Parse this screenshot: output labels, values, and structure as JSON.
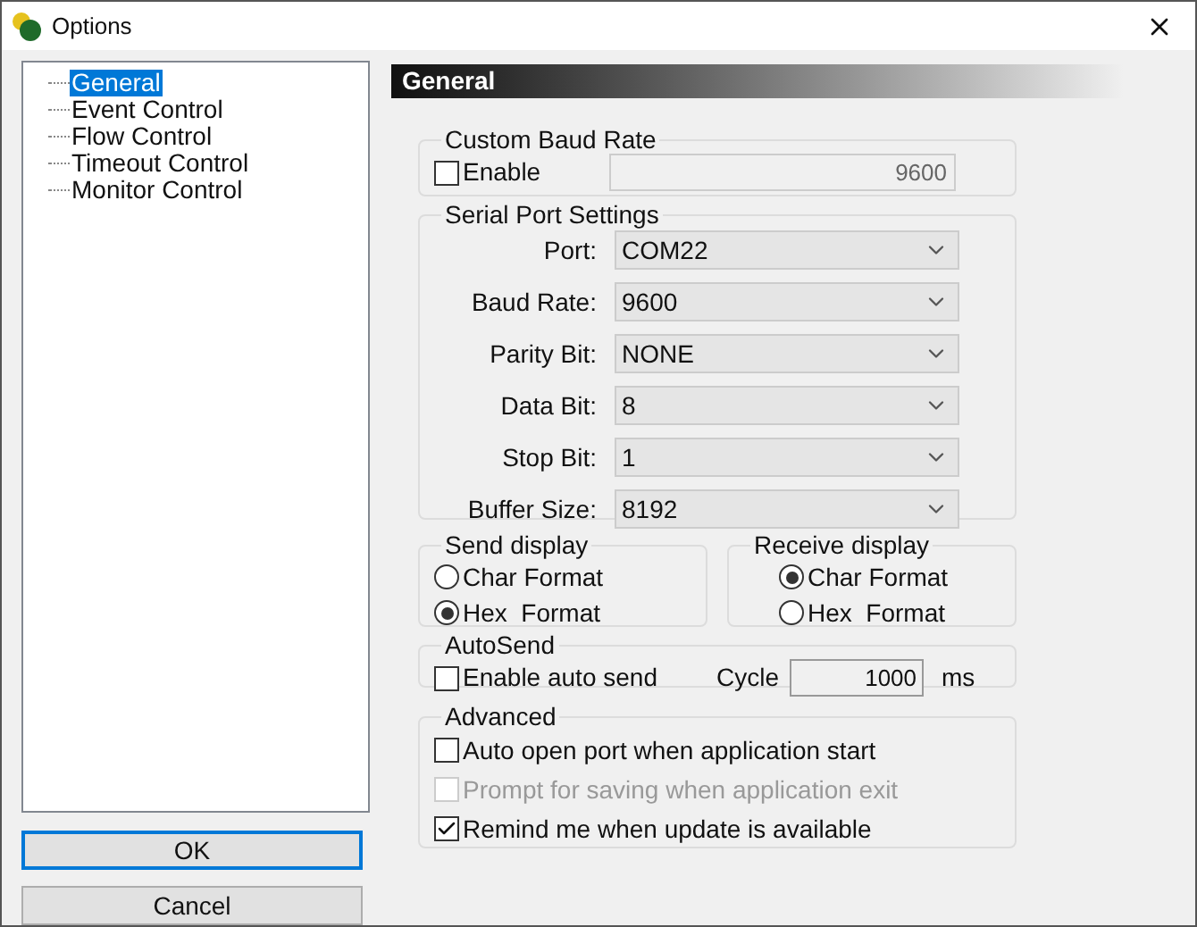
{
  "window": {
    "title": "Options"
  },
  "tree": {
    "items": [
      {
        "label": "General",
        "selected": true
      },
      {
        "label": "Event Control",
        "selected": false
      },
      {
        "label": "Flow Control",
        "selected": false
      },
      {
        "label": "Timeout Control",
        "selected": false
      },
      {
        "label": "Monitor Control",
        "selected": false
      }
    ]
  },
  "buttons": [
    {
      "label": "OK",
      "focused": true
    },
    {
      "label": "Cancel",
      "focused": false
    }
  ],
  "header": "General",
  "custom_baud_rate": {
    "title": "Custom Baud Rate",
    "enable": {
      "label": "Enable",
      "checked": false
    },
    "value": "9600"
  },
  "serial_port_settings": {
    "title": "Serial Port Settings",
    "fields": [
      {
        "label": "Port:",
        "value": "COM22"
      },
      {
        "label": "Baud Rate:",
        "value": "9600"
      },
      {
        "label": "Parity Bit:",
        "value": "NONE"
      },
      {
        "label": "Data Bit:",
        "value": "8"
      },
      {
        "label": "Stop Bit:",
        "value": "1"
      },
      {
        "label": "Buffer Size:",
        "value": "8192"
      }
    ]
  },
  "send_display": {
    "title": "Send display",
    "options": [
      {
        "label": "Char Format",
        "selected": false
      },
      {
        "label": "Hex  Format",
        "selected": true
      }
    ]
  },
  "receive_display": {
    "title": "Receive display",
    "options": [
      {
        "label": "Char Format",
        "selected": true
      },
      {
        "label": "Hex  Format",
        "selected": false
      }
    ]
  },
  "autosend": {
    "title": "AutoSend",
    "enable": {
      "label": "Enable auto send",
      "checked": false
    },
    "cycle_label": "Cycle",
    "cycle_value": "1000",
    "unit": "ms"
  },
  "advanced": {
    "title": "Advanced",
    "options": [
      {
        "label": "Auto open port when application start",
        "checked": false,
        "disabled": false
      },
      {
        "label": "Prompt for saving when application exit",
        "checked": false,
        "disabled": true
      },
      {
        "label": "Remind me when update is available",
        "checked": true,
        "disabled": false
      }
    ]
  }
}
